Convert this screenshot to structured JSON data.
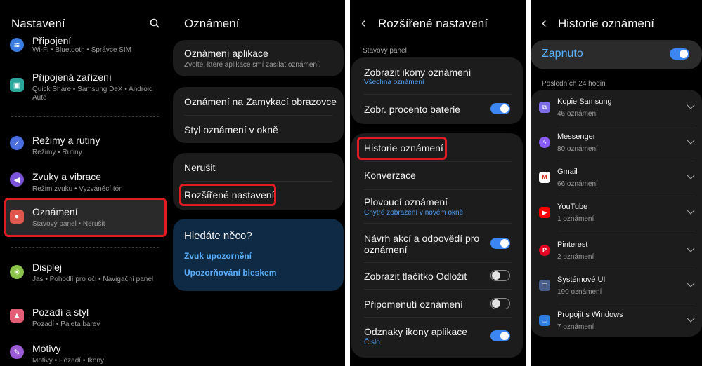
{
  "settings": {
    "title": "Nastavení",
    "items": [
      {
        "title": "Připojení",
        "sub": "Wi-Fi • Bluetooth • Správce SIM",
        "color": "#3b7be0"
      },
      {
        "title": "Připojená zařízení",
        "sub": "Quick Share • Samsung DeX • Android Auto",
        "color": "#2aa79a"
      },
      {
        "title": "Režimy a rutiny",
        "sub": "Režimy • Rutiny",
        "color": "#4b6fe0"
      },
      {
        "title": "Zvuky a vibrace",
        "sub": "Režim zvuku • Vyzváněcí tón",
        "color": "#7b55d9"
      },
      {
        "title": "Oznámení",
        "sub": "Stavový panel • Nerušit",
        "color": "#e0574f"
      },
      {
        "title": "Displej",
        "sub": "Jas • Pohodlí pro oči • Navigační panel",
        "color": "#8bc34a"
      },
      {
        "title": "Pozadí a styl",
        "sub": "Pozadí • Paleta barev",
        "color": "#e35d76"
      },
      {
        "title": "Motivy",
        "sub": "Motivy • Pozadí • Ikony",
        "color": "#9c5bd6"
      }
    ]
  },
  "notifications": {
    "title": "Oznámení",
    "app_notif_title": "Oznámení aplikace",
    "app_notif_sub": "Zvolte, které aplikace smí zasílat oznámení.",
    "lock_screen": "Oznámení na Zamykací obrazovce",
    "popup_style": "Styl oznámení v okně",
    "dnd": "Nerušit",
    "advanced": "Rozšířené nastavení",
    "search_title": "Hledáte něco?",
    "link1": "Zvuk upozornění",
    "link2": "Upozorňování bleskem"
  },
  "advanced": {
    "title": "Rozšířené nastavení",
    "section": "Stavový panel",
    "show_icons": "Zobrazit ikony oznámení",
    "show_icons_sub": "Všechna oznámení",
    "battery": "Zobr. procento baterie",
    "history": "Historie oznámení",
    "conversations": "Konverzace",
    "floating": "Plovoucí oznámení",
    "floating_sub": "Chytré zobrazení v novém okně",
    "suggest_line1": "Návrh akcí a odpovědí pro",
    "suggest_line2": "oznámení",
    "snooze": "Zobrazit tlačítko Odložit",
    "reminders": "Připomenutí oznámení",
    "badges": "Odznaky ikony aplikace",
    "badges_sub": "Číslo",
    "toggle_on_color": "#3b86f2"
  },
  "history": {
    "title": "Historie oznámení",
    "enabled_label": "Zapnuto",
    "period": "Posledních 24 hodin",
    "apps": [
      {
        "name": "Kopie Samsung",
        "count": "46 oznámení",
        "color": "#7e6ee6",
        "icon": "samsung-copy-icon"
      },
      {
        "name": "Messenger",
        "count": "80 oznámení",
        "color": "#8a5cf6",
        "icon": "messenger-icon"
      },
      {
        "name": "Gmail",
        "count": "66 oznámení",
        "color": "#ffffff",
        "icon": "gmail-icon"
      },
      {
        "name": "YouTube",
        "count": "1 oznámení",
        "color": "#ff0000",
        "icon": "youtube-icon"
      },
      {
        "name": "Pinterest",
        "count": "2 oznámení",
        "color": "#e60023",
        "icon": "pinterest-icon"
      },
      {
        "name": "Systémové UI",
        "count": "190 oznámení",
        "color": "#4a5e8c",
        "icon": "system-ui-icon"
      },
      {
        "name": "Propojit s Windows",
        "count": "7 oznámení",
        "color": "#2b7de0",
        "icon": "windows-link-icon"
      }
    ]
  }
}
